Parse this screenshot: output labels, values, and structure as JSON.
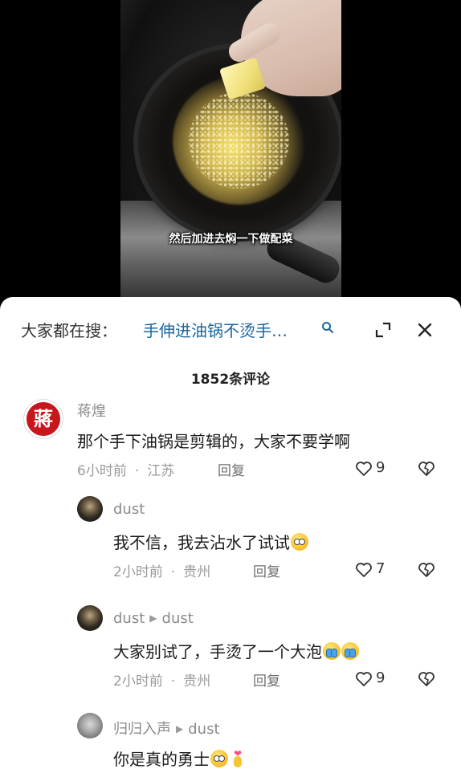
{
  "video": {
    "subtitle": "然后加进去焖一下做配菜"
  },
  "sheet": {
    "search_label": "大家都在搜：",
    "search_query": "手伸进油锅不烫手…",
    "comment_count": "1852条评论"
  },
  "comments": [
    {
      "author": "蒋煌",
      "avatar_text": "蔣",
      "text": "那个手下油锅是剪辑的，大家不要学啊",
      "time": "6小时前",
      "location": "江苏",
      "reply_label": "回复",
      "likes": "9"
    },
    {
      "author": "dust",
      "text": "我不信，我去沾水了试试",
      "time": "2小时前",
      "location": "贵州",
      "reply_label": "回复",
      "likes": "7"
    },
    {
      "author": "dust",
      "reply_to": "dust",
      "text": "大家别试了，手烫了一个大泡",
      "time": "2小时前",
      "location": "贵州",
      "reply_label": "回复",
      "likes": "9"
    },
    {
      "author": "归归入声",
      "reply_to": "dust",
      "text": "你是真的勇士"
    }
  ],
  "icons": {
    "search": "search-icon",
    "expand": "expand-icon",
    "close": "close-icon",
    "like": "heart-outline-icon",
    "dislike": "broken-heart-icon"
  },
  "colors": {
    "search_query": "#1b66a0",
    "avatar_top": "#c8161d",
    "meta_gray": "#9a9a9a"
  }
}
